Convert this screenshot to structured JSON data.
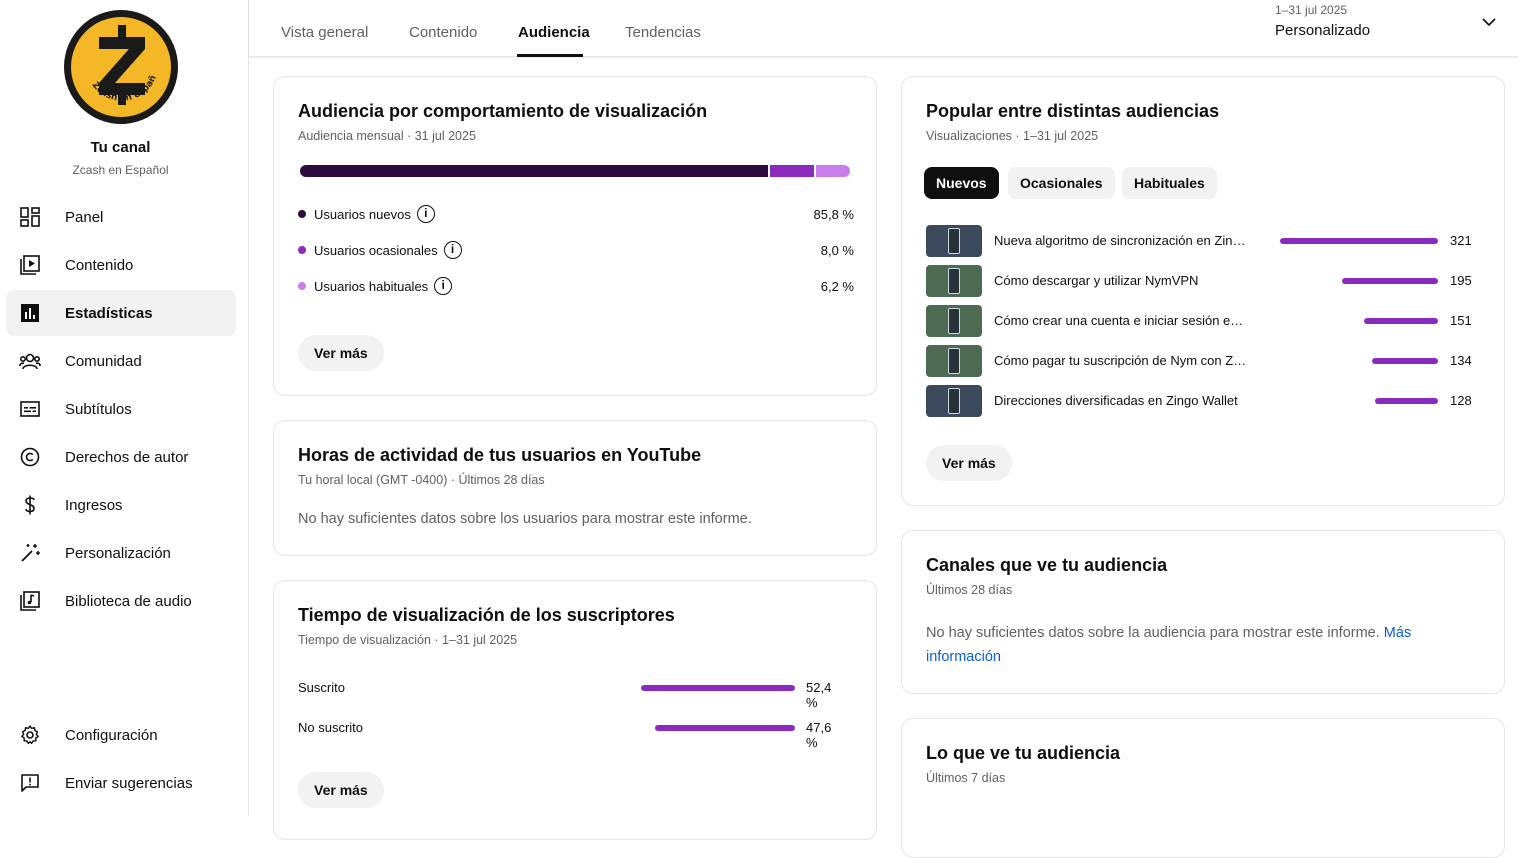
{
  "sidebar": {
    "channel_title": "Tu canal",
    "channel_name": "Zcash en Español",
    "avatar_text": "Zcash en español",
    "items": [
      {
        "label": "Panel",
        "icon": "dashboard-icon"
      },
      {
        "label": "Contenido",
        "icon": "content-icon"
      },
      {
        "label": "Estadísticas",
        "icon": "analytics-icon",
        "active": true
      },
      {
        "label": "Comunidad",
        "icon": "community-icon"
      },
      {
        "label": "Subtítulos",
        "icon": "subtitles-icon"
      },
      {
        "label": "Derechos de autor",
        "icon": "copyright-icon"
      },
      {
        "label": "Ingresos",
        "icon": "dollar-icon"
      },
      {
        "label": "Personalización",
        "icon": "magic-wand-icon"
      },
      {
        "label": "Biblioteca de audio",
        "icon": "audio-library-icon"
      }
    ],
    "bottom_items": [
      {
        "label": "Configuración",
        "icon": "gear-icon"
      },
      {
        "label": "Enviar sugerencias",
        "icon": "feedback-icon"
      }
    ]
  },
  "header": {
    "tabs": [
      "Vista general",
      "Contenido",
      "Audiencia",
      "Tendencias"
    ],
    "active_tab": "Audiencia",
    "date_range": "1–31 jul 2025",
    "date_preset": "Personalizado"
  },
  "behavior_card": {
    "title": "Audiencia por comportamiento de visualización",
    "subtitle": "Audiencia mensual · 31 jul 2025",
    "segments": [
      {
        "label": "Usuarios nuevos",
        "value": "85,8 %",
        "share": 85.8,
        "color": "#2b0a3d"
      },
      {
        "label": "Usuarios ocasionales",
        "value": "8,0 %",
        "share": 8.0,
        "color": "#8b2bbd"
      },
      {
        "label": "Usuarios habituales",
        "value": "6,2 %",
        "share": 6.2,
        "color": "#c77ee9"
      }
    ],
    "button": "Ver más"
  },
  "hours_card": {
    "title": "Horas de actividad de tus usuarios en YouTube",
    "subtitle": "Tu horal local (GMT -0400) · Últimos 28 días",
    "message": "No hay suficientes datos sobre los usuarios para mostrar este informe."
  },
  "subs_card": {
    "title": "Tiempo de visualización de los suscriptores",
    "subtitle": "Tiempo de visualización · 1–31 jul 2025",
    "rows": [
      {
        "label": "Suscrito",
        "value": "52,4 %",
        "share": 52.4
      },
      {
        "label": "No suscrito",
        "value": "47,6 %",
        "share": 47.6
      }
    ],
    "button": "Ver más"
  },
  "popular_card": {
    "title": "Popular entre distintas audiencias",
    "subtitle": "Visualizaciones · 1–31 jul 2025",
    "chips": [
      "Nuevos",
      "Ocasionales",
      "Habituales"
    ],
    "active_chip": "Nuevos",
    "videos": [
      {
        "title": "Nueva algoritmo de sincronización en Zingo Wallet",
        "views": 321,
        "views_label": "321",
        "thumb_color": "#3a4a5c"
      },
      {
        "title": "Cómo descargar y utilizar NymVPN",
        "views": 195,
        "views_label": "195",
        "thumb_color": "#4d6b52"
      },
      {
        "title": "Cómo crear una cuenta e iniciar sesión en NymVPN",
        "views": 151,
        "views_label": "151",
        "thumb_color": "#4d6b52"
      },
      {
        "title": "Cómo pagar tu suscripción de Nym con Zcash",
        "views": 134,
        "views_label": "134",
        "thumb_color": "#4d6b52"
      },
      {
        "title": "Direcciones diversificadas en Zingo Wallet",
        "views": 128,
        "views_label": "128",
        "thumb_color": "#3a4a5c"
      }
    ],
    "button": "Ver más"
  },
  "channels_card": {
    "title": "Canales que ve tu audiencia",
    "subtitle": "Últimos 28 días",
    "message": "No hay suficientes datos sobre la audiencia para mostrar este informe.",
    "link": "Más información"
  },
  "watch_card": {
    "title": "Lo que ve tu audiencia",
    "subtitle": "Últimos 7 días"
  },
  "colors": {
    "accent": "#8b2bbd",
    "dark": "#0f0f0f",
    "muted": "#606060"
  }
}
